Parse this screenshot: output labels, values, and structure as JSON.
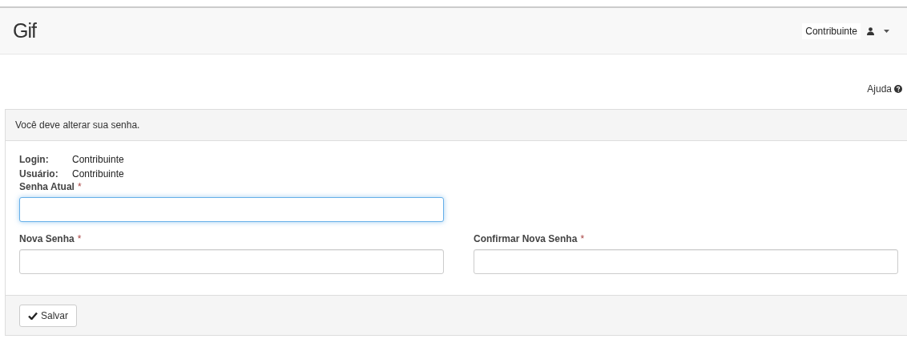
{
  "navbar": {
    "logo": "Gif",
    "user": "Contribuinte"
  },
  "help_link": {
    "label": "Ajuda"
  },
  "panel": {
    "heading": "Você deve alterar sua senha.",
    "info": [
      {
        "label": "Login:",
        "value": "Contribuinte"
      },
      {
        "label": "Usuário:",
        "value": "Contribuinte"
      }
    ],
    "fields": [
      {
        "label": "Senha Atual",
        "required_mark": "*",
        "focused": true,
        "full_row": true
      },
      {
        "label": "Nova Senha",
        "required_mark": "*",
        "focused": false,
        "full_row": false
      },
      {
        "label": "Confirmar Nova Senha",
        "required_mark": "*",
        "focused": false,
        "full_row": false
      }
    ],
    "save_button": "Salvar"
  }
}
